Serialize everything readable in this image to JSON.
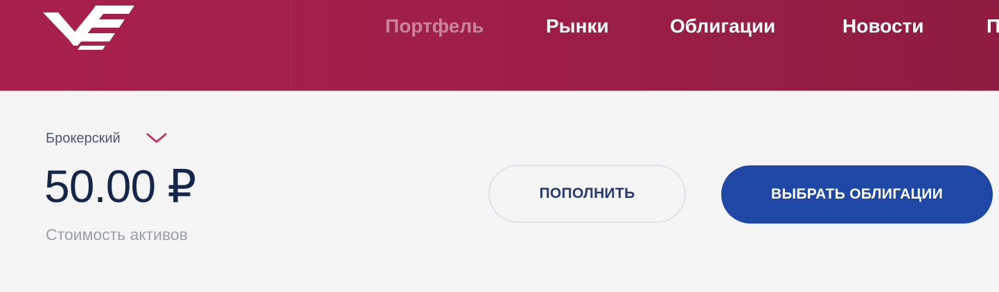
{
  "header": {
    "logo_icon": "vtb-logo-icon",
    "nav": [
      {
        "label": "Портфель",
        "active": true
      },
      {
        "label": "Рынки",
        "active": false
      },
      {
        "label": "Облигации",
        "active": false
      },
      {
        "label": "Новости",
        "active": false
      },
      {
        "label": "П",
        "active": false
      }
    ],
    "colors": {
      "bar": "#a8214c",
      "active_nav_text": "rgba(255,255,255,0.45)"
    }
  },
  "account": {
    "type_label": "Брокерский",
    "dropdown_icon": "chevron-down-icon",
    "balance": "50.00 ₽",
    "balance_caption": "Стоимость активов"
  },
  "actions": {
    "topup_label": "ПОПОЛНИТЬ",
    "choose_bonds_label": "ВЫБРАТЬ ОБЛИГАЦИИ",
    "primary_color": "#1f48a6",
    "secondary_text_color": "#243a73"
  }
}
